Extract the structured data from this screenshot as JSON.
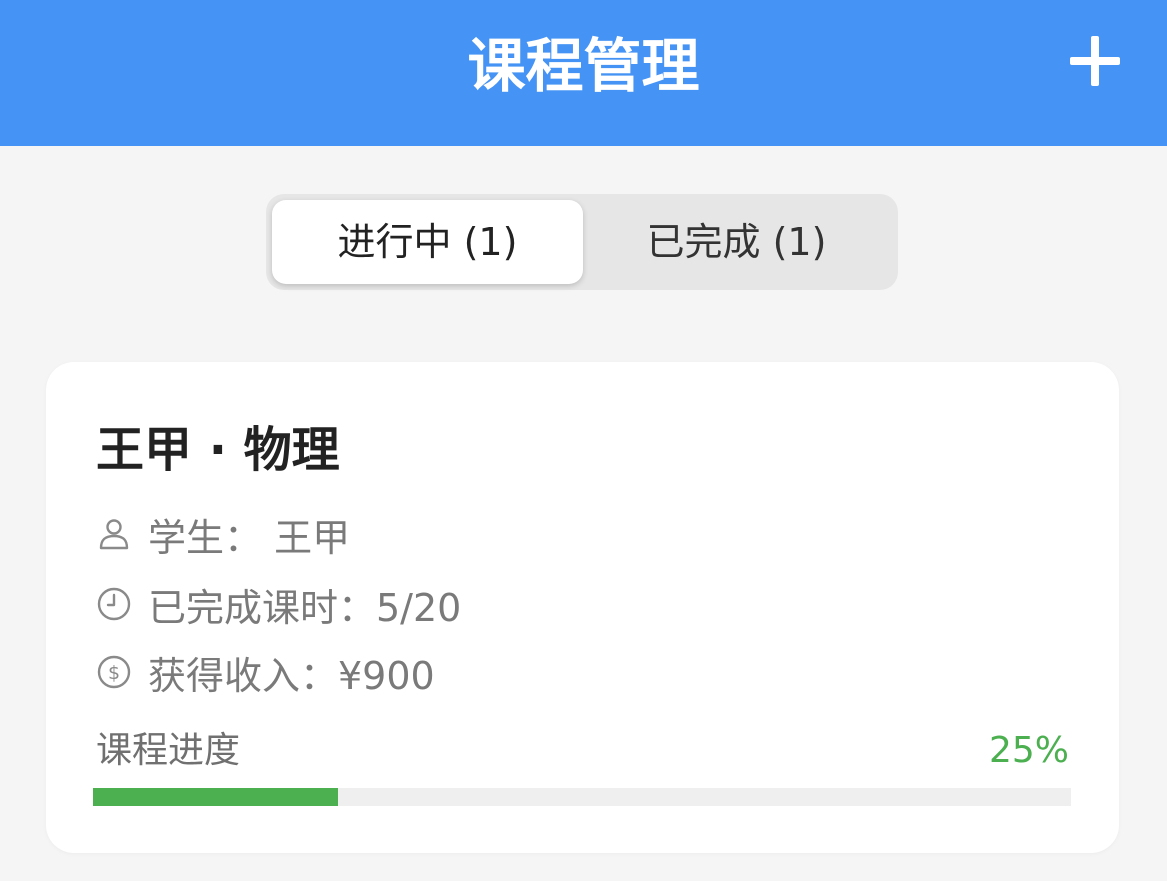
{
  "header": {
    "title": "课程管理",
    "add_icon": "plus-icon",
    "bg_color": "#4593f4"
  },
  "tabs": [
    {
      "label": "进行中 (1)",
      "active": true
    },
    {
      "label": "已完成 (1)",
      "active": false
    }
  ],
  "course": {
    "title": "王甲 · 物理",
    "student": {
      "icon": "person-icon",
      "text": "学生：  王甲"
    },
    "lessons": {
      "icon": "clock-icon",
      "text": "已完成课时：5/20"
    },
    "income": {
      "icon": "dollar-icon",
      "text": "获得收入：¥900"
    },
    "progress": {
      "label": "课程进度",
      "percent_text": "25%",
      "fraction": 0.25,
      "color": "#4caf50"
    }
  }
}
